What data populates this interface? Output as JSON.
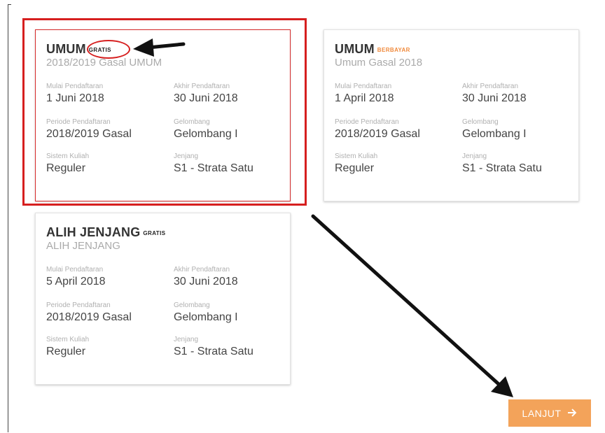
{
  "cards": [
    {
      "title": "UMUM",
      "badge": "GRATIS",
      "subtitle": "2018/2019 Gasal UMUM",
      "fields": {
        "mulai_label": "Mulai Pendaftaran",
        "mulai_value": "1 Juni 2018",
        "akhir_label": "Akhir Pendaftaran",
        "akhir_value": "30 Juni 2018",
        "periode_label": "Periode Pendaftaran",
        "periode_value": "2018/2019 Gasal",
        "gelombang_label": "Gelombang",
        "gelombang_value": "Gelombang I",
        "sistem_label": "Sistem Kuliah",
        "sistem_value": "Reguler",
        "jenjang_label": "Jenjang",
        "jenjang_value": "S1 - Strata Satu"
      }
    },
    {
      "title": "UMUM",
      "badge": "BERBAYAR",
      "subtitle": "Umum Gasal 2018",
      "fields": {
        "mulai_label": "Mulai Pendaftaran",
        "mulai_value": "1 April 2018",
        "akhir_label": "Akhir Pendaftaran",
        "akhir_value": "30 Juni 2018",
        "periode_label": "Periode Pendaftaran",
        "periode_value": "2018/2019 Gasal",
        "gelombang_label": "Gelombang",
        "gelombang_value": "Gelombang I",
        "sistem_label": "Sistem Kuliah",
        "sistem_value": "Reguler",
        "jenjang_label": "Jenjang",
        "jenjang_value": "S1 - Strata Satu"
      }
    },
    {
      "title": "ALIH JENJANG",
      "badge": "GRATIS",
      "subtitle": "ALIH JENJANG",
      "fields": {
        "mulai_label": "Mulai Pendaftaran",
        "mulai_value": "5 April 2018",
        "akhir_label": "Akhir Pendaftaran",
        "akhir_value": "30 Juni 2018",
        "periode_label": "Periode Pendaftaran",
        "periode_value": "2018/2019 Gasal",
        "gelombang_label": "Gelombang",
        "gelombang_value": "Gelombang I",
        "sistem_label": "Sistem Kuliah",
        "sistem_value": "Reguler",
        "jenjang_label": "Jenjang",
        "jenjang_value": "S1 - Strata Satu"
      }
    }
  ],
  "actions": {
    "next_label": "LANJUT"
  },
  "icons": {
    "next": "arrow-right-icon"
  },
  "colors": {
    "accent": "#f3a35a",
    "badge_paid": "#f08a3c",
    "annotation": "#d61f1f"
  }
}
